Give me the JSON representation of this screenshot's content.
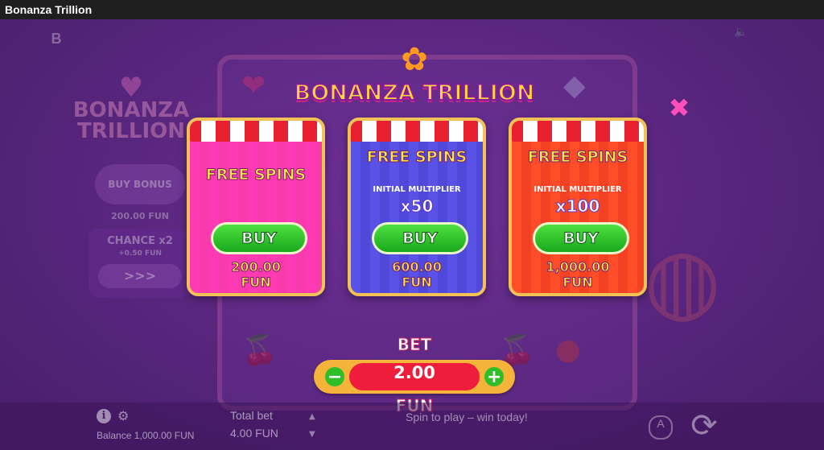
{
  "window": {
    "title": "Bonanza Trillion"
  },
  "game": {
    "logo_text": "BONANZA TRILLION",
    "side_logo_line1": "BONANZA",
    "side_logo_line2": "TRILLION",
    "corner_logo": "B",
    "buy_bonus": {
      "label": "BUY BONUS",
      "price": "200.00 FUN"
    },
    "chance": {
      "title": "CHANCE x2",
      "subtitle": "+0.50 FUN",
      "toggle": ">>>"
    }
  },
  "cards": [
    {
      "title": "FREE SPINS",
      "mult_label": "",
      "mult_value": "",
      "buy_label": "BUY",
      "price_line1": "200.00",
      "price_line2": "FUN"
    },
    {
      "title": "FREE SPINS",
      "mult_label": "INITIAL MULTIPLIER",
      "mult_value": "x50",
      "buy_label": "BUY",
      "price_line1": "600.00",
      "price_line2": "FUN"
    },
    {
      "title": "FREE SPINS",
      "mult_label": "INITIAL MULTIPLIER",
      "mult_value": "x100",
      "buy_label": "BUY",
      "price_line1": "1,000.00",
      "price_line2": "FUN"
    }
  ],
  "bet": {
    "label": "BET",
    "value": "2.00",
    "unit": "FUN",
    "minus": "−",
    "plus": "+"
  },
  "bottom": {
    "balance": "Balance 1,000.00 FUN",
    "total_bet_label": "Total bet",
    "total_bet_value": "4.00 FUN",
    "spin_message": "Spin to play – win today!",
    "auto_label": "A"
  },
  "colors": {
    "accent_pink": "#ff3ab4",
    "accent_blue": "#5a52e6",
    "accent_red": "#ff4d2a",
    "buy_green": "#2fbe2a",
    "gold_border": "#f3c257"
  }
}
